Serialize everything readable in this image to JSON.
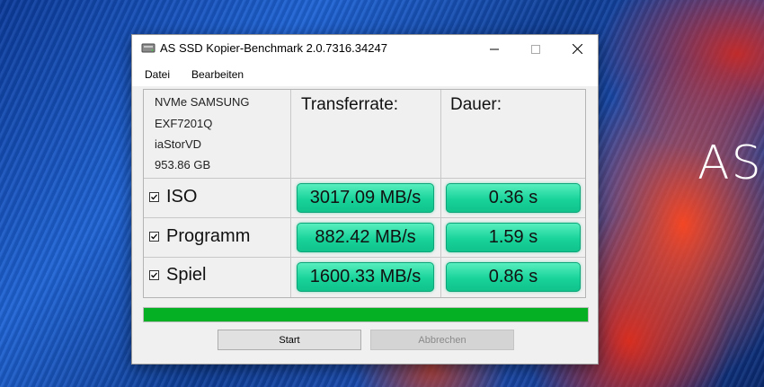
{
  "wallpaper": {
    "brand_text": "ASU"
  },
  "window": {
    "title": "AS SSD Kopier-Benchmark 2.0.7316.34247",
    "menu": [
      "Datei",
      "Bearbeiten"
    ]
  },
  "drive": {
    "lines": [
      "NVMe SAMSUNG",
      "EXF7201Q",
      "iaStorVD",
      "953.86 GB"
    ]
  },
  "columns": {
    "transfer": "Transferrate:",
    "duration": "Dauer:"
  },
  "rows": [
    {
      "label": "ISO",
      "checked": true,
      "transfer": "3017.09 MB/s",
      "duration": "0.36 s"
    },
    {
      "label": "Programm",
      "checked": true,
      "transfer": "882.42 MB/s",
      "duration": "1.59 s"
    },
    {
      "label": "Spiel",
      "checked": true,
      "transfer": "1600.33 MB/s",
      "duration": "0.86 s"
    }
  ],
  "progress": {
    "fraction": 1.0,
    "color": "#06b025"
  },
  "buttons": {
    "start": "Start",
    "cancel": "Abbrechen"
  },
  "colors": {
    "result_fill": "#18d39a",
    "window_bg": "#f0f0f0"
  },
  "icons": {
    "app": "drive-icon",
    "minimize": "minimize-icon",
    "maximize": "maximize-icon",
    "close": "close-icon",
    "check": "check-icon"
  }
}
